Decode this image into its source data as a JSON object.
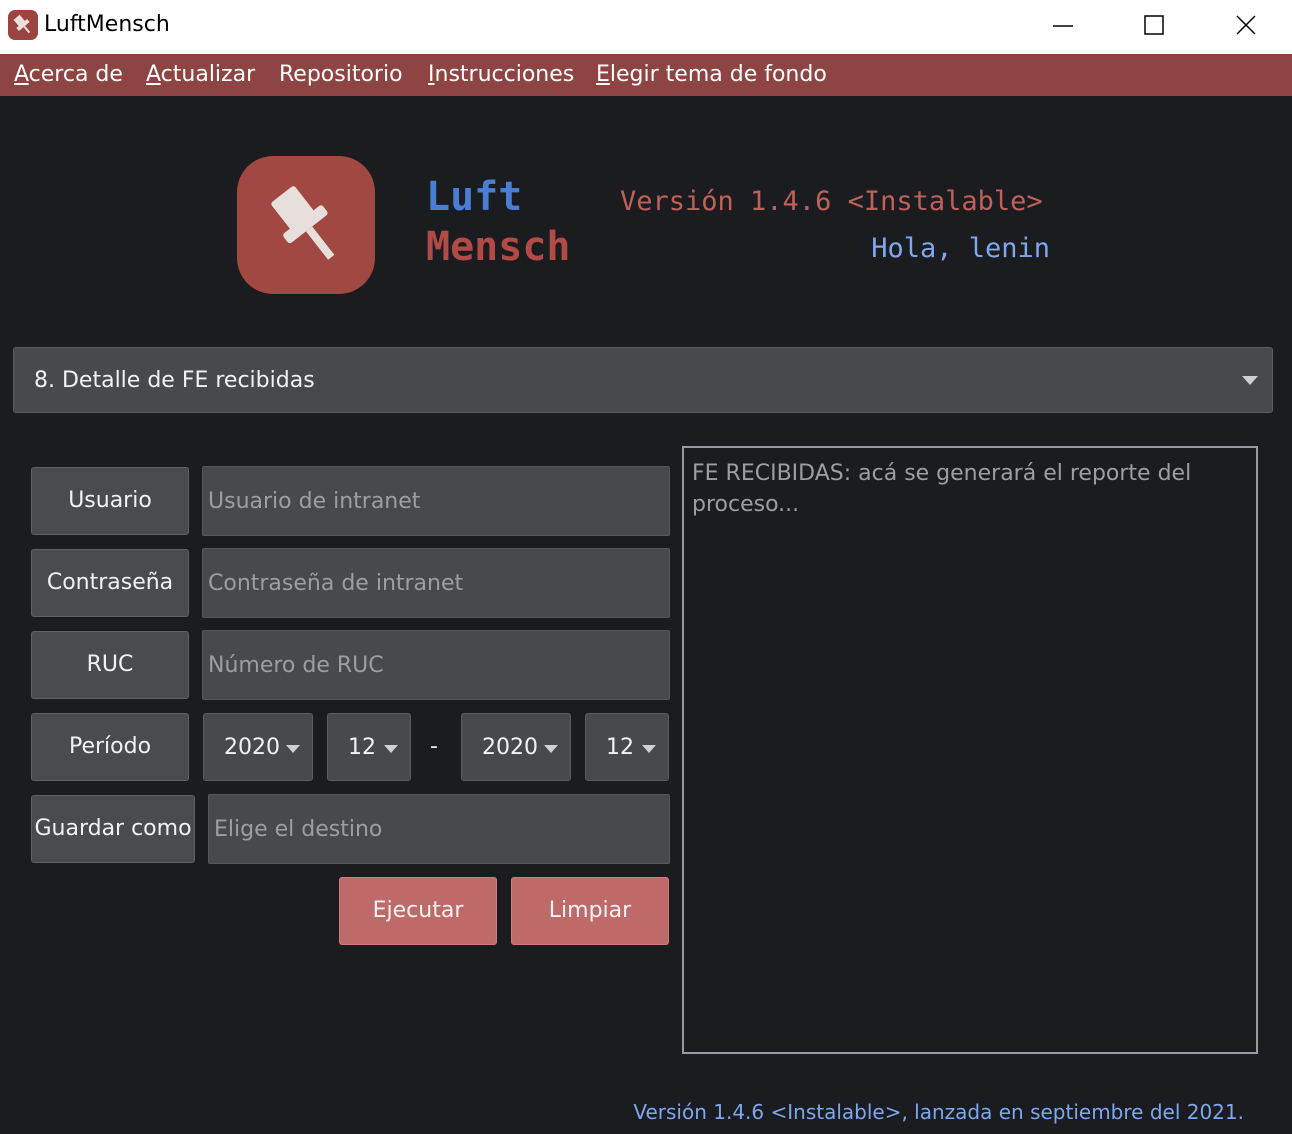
{
  "window": {
    "title": "LuftMensch",
    "controls": [
      "minimize-icon",
      "maximize-icon",
      "close-icon"
    ]
  },
  "menu": [
    {
      "first": "A",
      "rest": "cerca de"
    },
    {
      "first": "A",
      "rest": "ctualizar"
    },
    {
      "first": "",
      "rest": "Repositorio"
    },
    {
      "first": "I",
      "rest": "nstrucciones"
    },
    {
      "first": "E",
      "rest": "legir tema de fondo"
    }
  ],
  "header": {
    "brand_line1": "Luft",
    "brand_line2": "Mensch",
    "version": "Versión 1.4.6 <Instalable>",
    "greeting": "Hola, lenin"
  },
  "process_select": {
    "value": "8. Detalle de FE recibidas"
  },
  "form": {
    "user_label": "Usuario",
    "user_placeholder": "Usuario de intranet",
    "password_label": "Contraseña",
    "password_placeholder": "Contraseña de intranet",
    "ruc_label": "RUC",
    "ruc_placeholder": "Número de RUC",
    "period_label": "Período",
    "period_start_year": "2020",
    "period_start_month": "12",
    "period_separator": "-",
    "period_end_year": "2020",
    "period_end_month": "12",
    "save_label": "Guardar como",
    "save_placeholder": "Elige el destino",
    "run_label": "Ejecutar",
    "clear_label": "Limpiar"
  },
  "report": {
    "text": "FE RECIBIDAS: acá se generará el reporte del proceso..."
  },
  "footer": {
    "text": "Versión 1.4.6 <Instalable>, lanzada en septiembre del 2021."
  },
  "colors": {
    "menubar": "#8f4444",
    "accent_red": "#bd6a69",
    "brand_blue": "#4a7ed6",
    "brand_red": "#b24a45",
    "version_red": "#c0605a",
    "greeting_blue": "#7fa7ee",
    "background": "#1b1c1f"
  }
}
